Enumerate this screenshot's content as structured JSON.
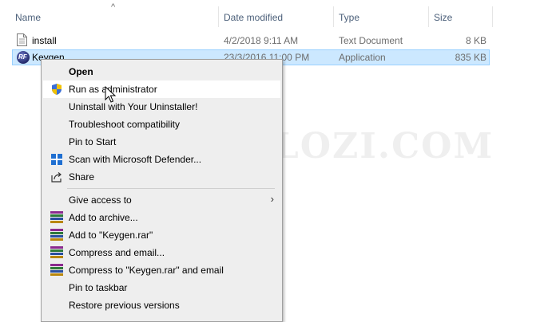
{
  "columns": {
    "name": "Name",
    "date_modified": "Date modified",
    "type": "Type",
    "size": "Size"
  },
  "files": [
    {
      "name": "install",
      "date": "4/2/2018 9:11 AM",
      "type": "Text Document",
      "size": "8 KB",
      "icon": "text-document-icon",
      "selected": false
    },
    {
      "name": "Keygen",
      "date": "23/3/2016 11:00 PM",
      "type": "Application",
      "size": "835 KB",
      "icon": "keygen-app-icon",
      "selected": true
    }
  ],
  "watermark": "ITDOLOZI.COM",
  "context_menu": {
    "items": [
      {
        "label": "Open",
        "bold": true,
        "icon": "",
        "submenu": false
      },
      {
        "label": "Run as administrator",
        "icon": "uac-shield-icon",
        "hover": true
      },
      {
        "label": "Uninstall with Your Uninstaller!",
        "icon": ""
      },
      {
        "label": "Troubleshoot compatibility",
        "icon": ""
      },
      {
        "label": "Pin to Start",
        "icon": ""
      },
      {
        "label": "Scan with Microsoft Defender...",
        "icon": "defender-icon"
      },
      {
        "label": "Share",
        "icon": "share-icon"
      },
      {
        "label": "Give access to",
        "icon": "",
        "submenu": true
      },
      {
        "label": "Add to archive...",
        "icon": "winrar-icon"
      },
      {
        "label": "Add to \"Keygen.rar\"",
        "icon": "winrar-icon"
      },
      {
        "label": "Compress and email...",
        "icon": "winrar-icon"
      },
      {
        "label": "Compress to \"Keygen.rar\" and email",
        "icon": "winrar-icon"
      },
      {
        "label": "Pin to taskbar",
        "icon": ""
      },
      {
        "label": "Restore previous versions",
        "icon": ""
      }
    ],
    "submenu_glyph": "›"
  },
  "colors": {
    "selection_bg": "#cce8ff",
    "selection_border": "#99d1ff",
    "menu_bg": "#eeeeee",
    "header_text": "#4c607a"
  }
}
